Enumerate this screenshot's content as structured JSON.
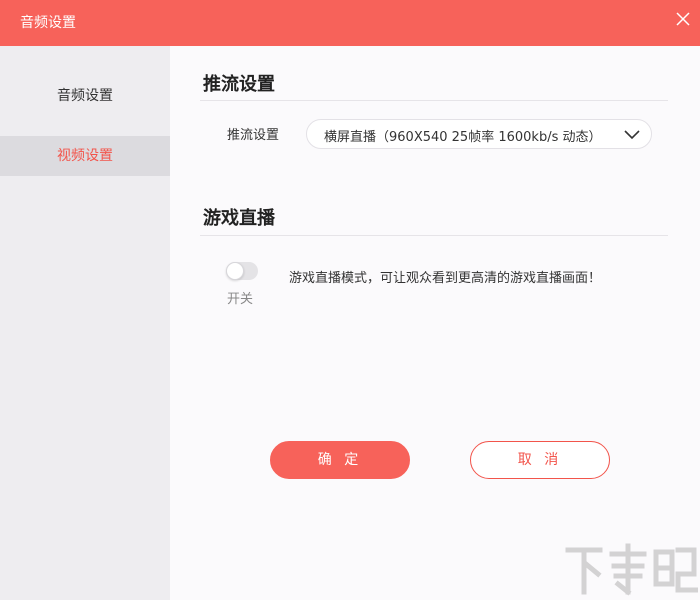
{
  "window": {
    "title": "音频设置",
    "close_icon": "close-icon"
  },
  "sidebar": {
    "items": [
      {
        "label": "音频设置",
        "active": false
      },
      {
        "label": "视频设置",
        "active": true
      }
    ]
  },
  "stream_section": {
    "title": "推流设置",
    "field_label": "推流设置",
    "dropdown_value": "横屏直播（960X540  25帧率  1600kb/s 动态）"
  },
  "game_section": {
    "title": "游戏直播",
    "toggle_label": "开关",
    "toggle_on": false,
    "description": "游戏直播模式，可让观众看到更高清的游戏直播画面！"
  },
  "buttons": {
    "ok_label": "确 定",
    "cancel_label": "取 消"
  },
  "colors": {
    "accent": "#f7625a",
    "active_text": "#f2544b",
    "sidebar_bg": "#eeedf0",
    "sidebar_active_bg": "#dcdbdf"
  },
  "watermark": {
    "text": "下载吧"
  }
}
